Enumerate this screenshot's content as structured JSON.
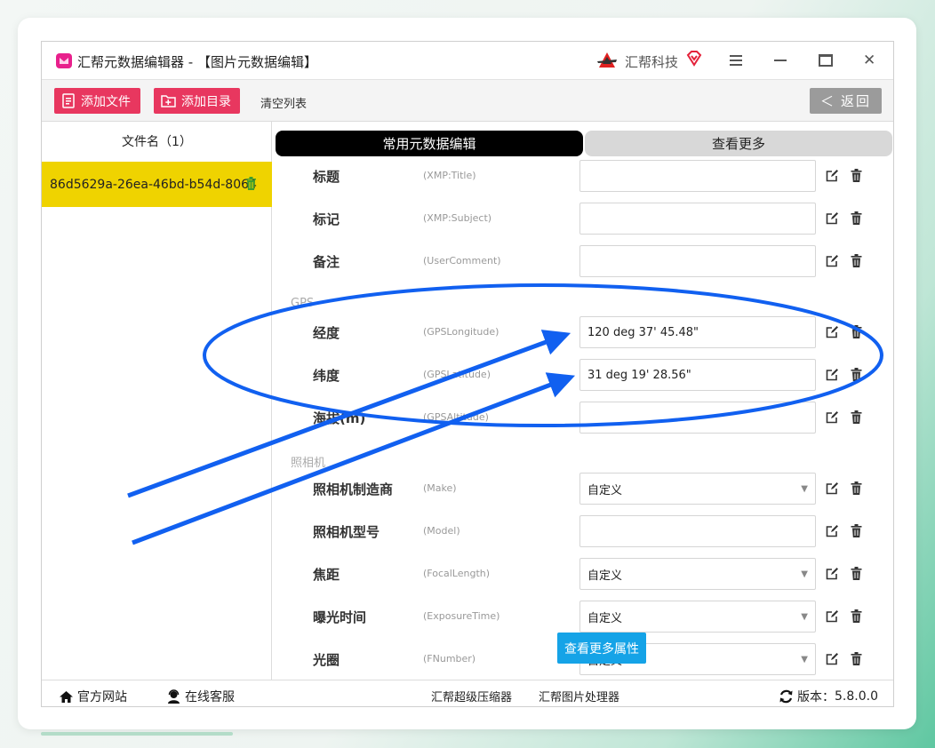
{
  "window": {
    "title": "汇帮元数据编辑器 - 【图片元数据编辑】",
    "brand": "汇帮科技"
  },
  "toolbar": {
    "add_file": "添加文件",
    "add_dir": "添加目录",
    "clear_list": "清空列表",
    "back": "返回"
  },
  "sidebar": {
    "header": "文件名（1）",
    "files": [
      "86d5629a-26ea-46bd-b54d-8064"
    ]
  },
  "tabs": {
    "common": "常用元数据编辑",
    "more": "查看更多"
  },
  "fields": [
    {
      "label": "标题",
      "key": "(XMP:Title)",
      "value": ""
    },
    {
      "label": "标记",
      "key": "(XMP:Subject)",
      "value": ""
    },
    {
      "label": "备注",
      "key": "(UserComment)",
      "value": ""
    },
    {
      "label": "经度",
      "key": "(GPSLongitude)",
      "value": "120 deg 37' 45.48\""
    },
    {
      "label": "纬度",
      "key": "(GPSLatitude)",
      "value": "31 deg 19' 28.56\""
    },
    {
      "label": "海拔(m)",
      "key": "(GPSAltitude)",
      "value": ""
    },
    {
      "label": "照相机制造商",
      "key": "(Make)",
      "value": "自定义",
      "dropdown": true
    },
    {
      "label": "照相机型号",
      "key": "(Model)",
      "value": ""
    },
    {
      "label": "焦距",
      "key": "(FocalLength)",
      "value": "自定义",
      "dropdown": true
    },
    {
      "label": "曝光时间",
      "key": "(ExposureTime)",
      "value": "自定义",
      "dropdown": true
    },
    {
      "label": "光圈",
      "key": "(FNumber)",
      "value": "自定义",
      "dropdown": true
    }
  ],
  "sections": {
    "gps": "GPS",
    "camera": "照相机"
  },
  "more_attrs": "查看更多属性",
  "footer": {
    "website": "官方网站",
    "support": "在线客服",
    "compressor": "汇帮超级压缩器",
    "image_processor": "汇帮图片处理器",
    "version_label": "版本：",
    "version": "5.8.0.0"
  },
  "colors": {
    "accent_red": "#e8375f",
    "selected_file": "#efd300",
    "annotation_blue": "#1160f0",
    "more_attrs": "#15a3e7"
  },
  "annotations": {
    "icons": [
      "highlight-ellipse",
      "arrow"
    ]
  }
}
